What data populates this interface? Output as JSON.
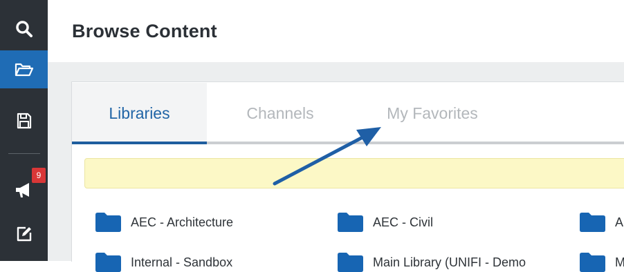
{
  "page": {
    "title": "Browse Content"
  },
  "sidebar": {
    "items": [
      {
        "name": "search",
        "icon": "search-icon"
      },
      {
        "name": "browse",
        "icon": "folder-open-icon",
        "active": true
      },
      {
        "name": "save",
        "icon": "floppy-disk-icon"
      },
      {
        "name": "announcements",
        "icon": "megaphone-icon",
        "badge": "9"
      },
      {
        "name": "edit",
        "icon": "edit-square-icon"
      }
    ]
  },
  "tabs": [
    {
      "label": "Libraries",
      "active": true
    },
    {
      "label": "Channels",
      "active": false
    },
    {
      "label": "My Favorites",
      "active": false
    }
  ],
  "folders": [
    {
      "label": "AEC - Architecture"
    },
    {
      "label": "AEC - Civil"
    },
    {
      "label": "A"
    },
    {
      "label": "Internal - Sandbox"
    },
    {
      "label": "Main Library (UNIFI - Demo"
    },
    {
      "label": "M"
    }
  ],
  "colors": {
    "sidebar_bg": "#2c3137",
    "sidebar_active": "#1f6cb5",
    "accent_blue": "#1f5e9e",
    "badge_red": "#d93737",
    "notice_bg": "#fcf8c6",
    "folder_blue": "#1765b3"
  }
}
